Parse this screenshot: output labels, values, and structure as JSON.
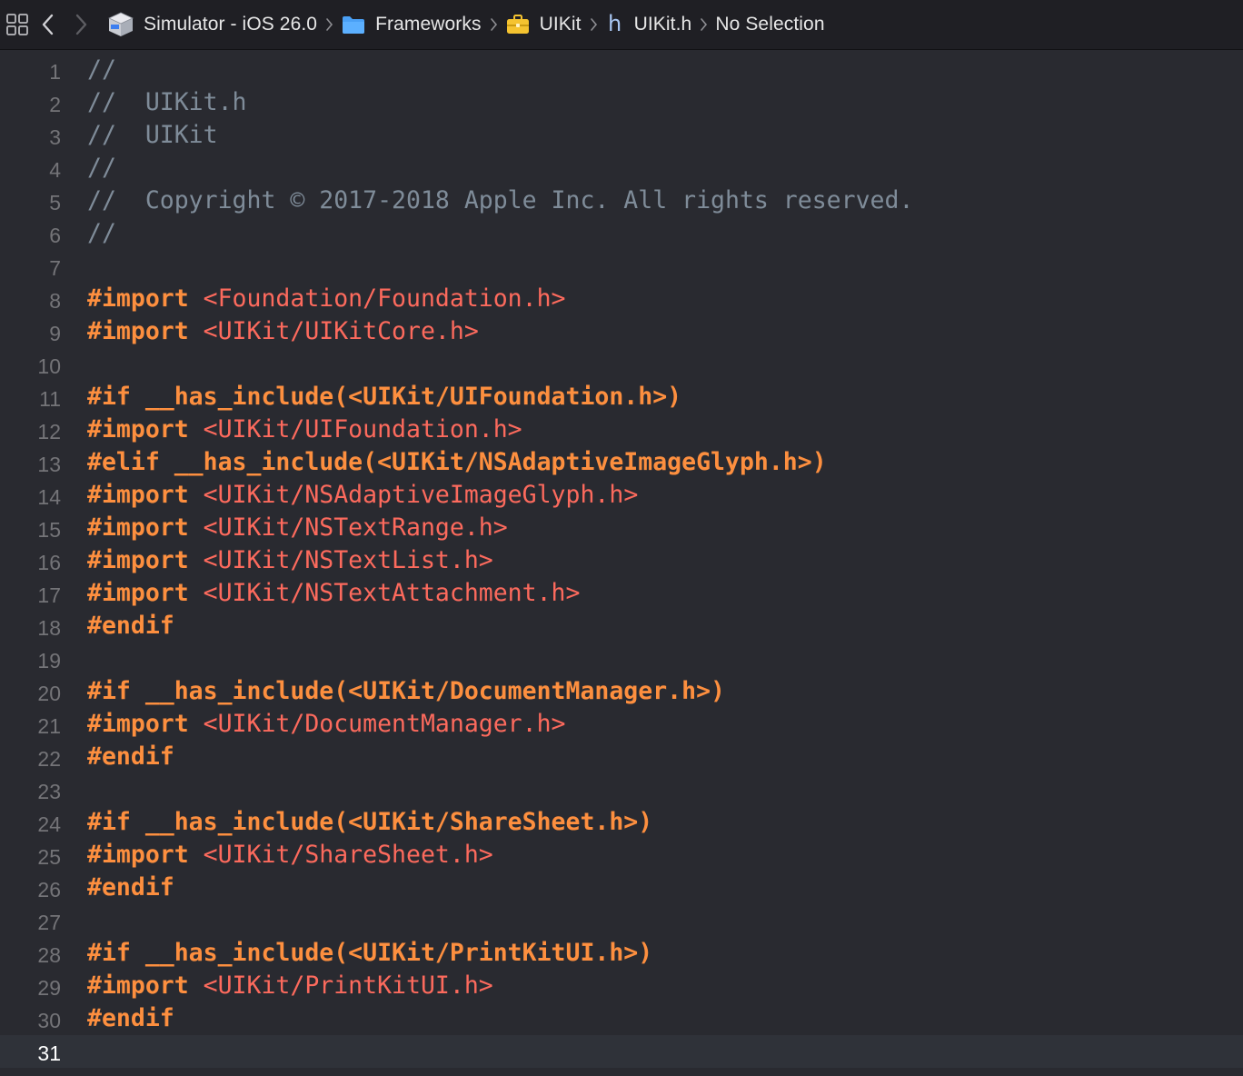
{
  "jumpbar": {
    "grid_icon": "related-items-grid-icon",
    "back_icon": "chevron-left-icon",
    "forward_icon": "chevron-right-icon",
    "crumbs": [
      {
        "label": "Simulator - iOS 26.0",
        "icon": "sdk-box-icon"
      },
      {
        "label": "Frameworks",
        "icon": "folder-icon"
      },
      {
        "label": "UIKit",
        "icon": "framework-toolbox-icon"
      },
      {
        "label": "UIKit.h",
        "icon": "header-file-icon",
        "glyph": "h"
      },
      {
        "label": "No Selection"
      }
    ],
    "separator": "〉"
  },
  "colors": {
    "background": "#292a30",
    "comment": "#7f8c99",
    "directive": "#fd8f3f",
    "path": "#fc6a5d",
    "line_number": "#747478",
    "current_line_bg": "#2f3239"
  },
  "editor": {
    "current_line": 31,
    "lines": [
      {
        "n": "1",
        "tokens": [
          {
            "t": "comment",
            "v": "//"
          }
        ]
      },
      {
        "n": "2",
        "tokens": [
          {
            "t": "comment",
            "v": "//  UIKit.h"
          }
        ]
      },
      {
        "n": "3",
        "tokens": [
          {
            "t": "comment",
            "v": "//  UIKit"
          }
        ]
      },
      {
        "n": "4",
        "tokens": [
          {
            "t": "comment",
            "v": "//"
          }
        ]
      },
      {
        "n": "5",
        "tokens": [
          {
            "t": "comment",
            "v": "//  Copyright © 2017-2018 Apple Inc. All rights reserved."
          }
        ]
      },
      {
        "n": "6",
        "tokens": [
          {
            "t": "comment",
            "v": "//"
          }
        ]
      },
      {
        "n": "7",
        "tokens": []
      },
      {
        "n": "8",
        "tokens": [
          {
            "t": "directive",
            "v": "#import "
          },
          {
            "t": "path",
            "v": "<Foundation/Foundation.h>"
          }
        ]
      },
      {
        "n": "9",
        "tokens": [
          {
            "t": "directive",
            "v": "#import "
          },
          {
            "t": "path",
            "v": "<UIKit/UIKitCore.h>"
          }
        ]
      },
      {
        "n": "10",
        "tokens": []
      },
      {
        "n": "11",
        "tokens": [
          {
            "t": "directive",
            "v": "#if __has_include(<UIKit/UIFoundation.h>)"
          }
        ]
      },
      {
        "n": "12",
        "tokens": [
          {
            "t": "directive",
            "v": "#import "
          },
          {
            "t": "path",
            "v": "<UIKit/UIFoundation.h>"
          }
        ]
      },
      {
        "n": "13",
        "tokens": [
          {
            "t": "directive",
            "v": "#elif __has_include(<UIKit/NSAdaptiveImageGlyph.h>)"
          }
        ]
      },
      {
        "n": "14",
        "tokens": [
          {
            "t": "directive",
            "v": "#import "
          },
          {
            "t": "path",
            "v": "<UIKit/NSAdaptiveImageGlyph.h>"
          }
        ]
      },
      {
        "n": "15",
        "tokens": [
          {
            "t": "directive",
            "v": "#import "
          },
          {
            "t": "path",
            "v": "<UIKit/NSTextRange.h>"
          }
        ]
      },
      {
        "n": "16",
        "tokens": [
          {
            "t": "directive",
            "v": "#import "
          },
          {
            "t": "path",
            "v": "<UIKit/NSTextList.h>"
          }
        ]
      },
      {
        "n": "17",
        "tokens": [
          {
            "t": "directive",
            "v": "#import "
          },
          {
            "t": "path",
            "v": "<UIKit/NSTextAttachment.h>"
          }
        ]
      },
      {
        "n": "18",
        "tokens": [
          {
            "t": "directive",
            "v": "#endif"
          }
        ]
      },
      {
        "n": "19",
        "tokens": []
      },
      {
        "n": "20",
        "tokens": [
          {
            "t": "directive",
            "v": "#if __has_include(<UIKit/DocumentManager.h>)"
          }
        ]
      },
      {
        "n": "21",
        "tokens": [
          {
            "t": "directive",
            "v": "#import "
          },
          {
            "t": "path",
            "v": "<UIKit/DocumentManager.h>"
          }
        ]
      },
      {
        "n": "22",
        "tokens": [
          {
            "t": "directive",
            "v": "#endif"
          }
        ]
      },
      {
        "n": "23",
        "tokens": []
      },
      {
        "n": "24",
        "tokens": [
          {
            "t": "directive",
            "v": "#if __has_include(<UIKit/ShareSheet.h>)"
          }
        ]
      },
      {
        "n": "25",
        "tokens": [
          {
            "t": "directive",
            "v": "#import "
          },
          {
            "t": "path",
            "v": "<UIKit/ShareSheet.h>"
          }
        ]
      },
      {
        "n": "26",
        "tokens": [
          {
            "t": "directive",
            "v": "#endif"
          }
        ]
      },
      {
        "n": "27",
        "tokens": []
      },
      {
        "n": "28",
        "tokens": [
          {
            "t": "directive",
            "v": "#if __has_include(<UIKit/PrintKitUI.h>)"
          }
        ]
      },
      {
        "n": "29",
        "tokens": [
          {
            "t": "directive",
            "v": "#import "
          },
          {
            "t": "path",
            "v": "<UIKit/PrintKitUI.h>"
          }
        ]
      },
      {
        "n": "30",
        "tokens": [
          {
            "t": "directive",
            "v": "#endif"
          }
        ]
      },
      {
        "n": "31",
        "tokens": []
      }
    ]
  }
}
